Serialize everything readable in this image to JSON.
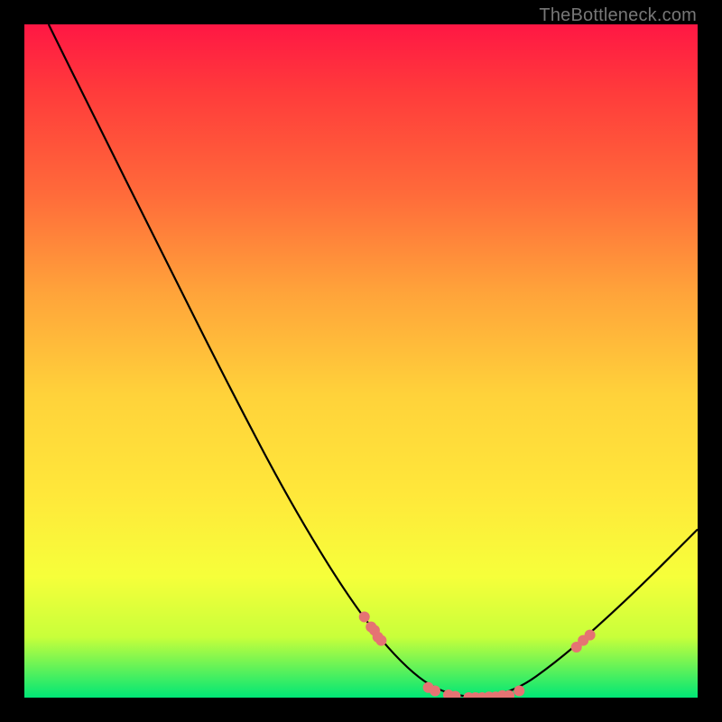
{
  "attribution": "TheBottleneck.com",
  "chart_data": {
    "type": "line",
    "title": "",
    "xlabel": "",
    "ylabel": "",
    "xlim": [
      0,
      100
    ],
    "ylim": [
      0,
      100
    ],
    "curve": [
      {
        "x": 3.6,
        "y": 100
      },
      {
        "x": 10,
        "y": 87
      },
      {
        "x": 20,
        "y": 67
      },
      {
        "x": 30,
        "y": 47
      },
      {
        "x": 40,
        "y": 28
      },
      {
        "x": 50,
        "y": 12
      },
      {
        "x": 58,
        "y": 3
      },
      {
        "x": 64,
        "y": 0
      },
      {
        "x": 72,
        "y": 0.3
      },
      {
        "x": 80,
        "y": 6
      },
      {
        "x": 90,
        "y": 15
      },
      {
        "x": 100,
        "y": 25
      }
    ],
    "markers": [
      {
        "x": 50.5,
        "y": 12.0
      },
      {
        "x": 51.5,
        "y": 10.5
      },
      {
        "x": 52.0,
        "y": 10.0
      },
      {
        "x": 52.5,
        "y": 9.0
      },
      {
        "x": 53.0,
        "y": 8.5
      },
      {
        "x": 60.0,
        "y": 1.5
      },
      {
        "x": 61.0,
        "y": 1.0
      },
      {
        "x": 63.0,
        "y": 0.4
      },
      {
        "x": 64.0,
        "y": 0.2
      },
      {
        "x": 66.0,
        "y": 0.0
      },
      {
        "x": 67.0,
        "y": 0.0
      },
      {
        "x": 68.0,
        "y": 0.0
      },
      {
        "x": 69.0,
        "y": 0.1
      },
      {
        "x": 70.0,
        "y": 0.1
      },
      {
        "x": 71.0,
        "y": 0.3
      },
      {
        "x": 72.0,
        "y": 0.3
      },
      {
        "x": 73.5,
        "y": 1.0
      },
      {
        "x": 82.0,
        "y": 7.5
      },
      {
        "x": 83.0,
        "y": 8.5
      },
      {
        "x": 84.0,
        "y": 9.3
      }
    ],
    "marker_color": "#e57373",
    "curve_color": "#000000"
  }
}
